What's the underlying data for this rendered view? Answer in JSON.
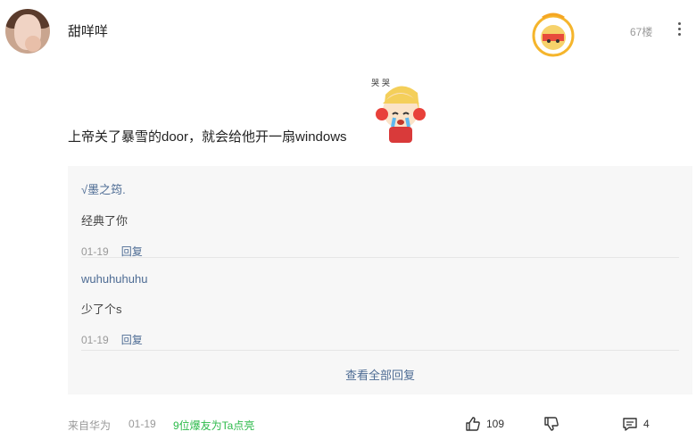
{
  "header": {
    "username": "甜咩咩",
    "badge_icon": "hot-comment-badge-icon",
    "floor": "67楼",
    "more_icon": "more-vertical-icon"
  },
  "comment": {
    "text": "上帝关了暴雪的door，就会给他开一扇windows",
    "sticker_icon": "crying-anime-sticker"
  },
  "replies": [
    {
      "name": "√墨之筠.",
      "text": "经典了你",
      "date": "01-19",
      "reply_label": "回复"
    },
    {
      "name": "wuhuhuhuhu",
      "text": "少了个s",
      "date": "01-19",
      "reply_label": "回复"
    }
  ],
  "view_all": "查看全部回复",
  "footer": {
    "source": "来自华为",
    "date": "01-19",
    "hot_text": "9位爆友为Ta点亮",
    "likes": "109",
    "comments": "4"
  },
  "colors": {
    "link": "#4e6c94",
    "hot": "#2cba4a",
    "reply_bg": "#f7f7f7"
  }
}
